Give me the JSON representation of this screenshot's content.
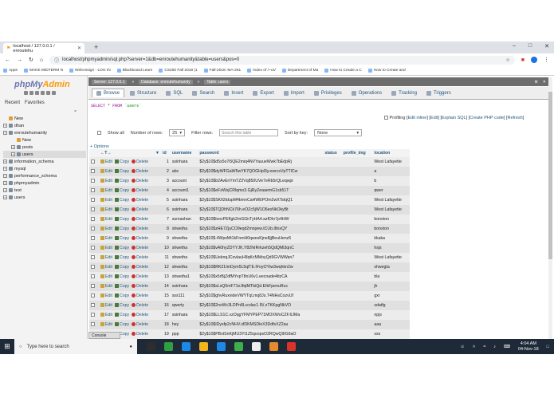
{
  "browser": {
    "tab_title": "localhost / 127.0.0.1 / enroutehu",
    "url": "localhost/phpmyadmin/sql.php?server=1&db=enroutehumanity&table=users&pos=0",
    "bookmarks": [
      "Apps",
      "MAKE MIDTERM N",
      "WebAssign - LOG IN",
      "Blackboard Learn",
      "CS250 Fall 2018 (1",
      "Fall-2018: MA-261",
      "Index of /~cs/",
      "Department of Ma",
      "How to Create a C",
      "How to Create and"
    ]
  },
  "sidebar": {
    "logo_main": "phpMy",
    "logo_accent": "Admin",
    "tabs": [
      "Recent",
      "Favorites"
    ],
    "tree": [
      {
        "label": "New",
        "level": 0,
        "kind": "new"
      },
      {
        "label": "dhan",
        "level": 0,
        "kind": "db"
      },
      {
        "label": "enroutehumanity",
        "level": 0,
        "kind": "db"
      },
      {
        "label": "New",
        "level": 1,
        "kind": "new"
      },
      {
        "label": "posts",
        "level": 1,
        "kind": "table"
      },
      {
        "label": "users",
        "level": 1,
        "kind": "table",
        "selected": true
      },
      {
        "label": "information_schema",
        "level": 0,
        "kind": "db"
      },
      {
        "label": "mysql",
        "level": 0,
        "kind": "db"
      },
      {
        "label": "performance_schema",
        "level": 0,
        "kind": "db"
      },
      {
        "label": "phpmyadmin",
        "level": 0,
        "kind": "db"
      },
      {
        "label": "test",
        "level": 0,
        "kind": "db"
      },
      {
        "label": "users",
        "level": 0,
        "kind": "db"
      }
    ]
  },
  "breadcrumb": {
    "server": "Server: 127.0.0.1",
    "database": "Database: enroutehumanity",
    "table": "Table: users"
  },
  "menu": [
    "Browse",
    "Structure",
    "SQL",
    "Search",
    "Insert",
    "Export",
    "Import",
    "Privileges",
    "Operations",
    "Tracking",
    "Triggers"
  ],
  "query": {
    "select": "SELECT",
    "star": "*",
    "from": "FROM",
    "table": "`users`"
  },
  "profiling": {
    "label": "Profiling",
    "links": [
      "Edit inline",
      "Edit",
      "Explain SQL",
      "Create PHP code",
      "Refresh"
    ]
  },
  "controls": {
    "show_all": "Show all",
    "rows_label": "Number of rows:",
    "rows_value": "25",
    "filter_label": "Filter rows:",
    "filter_placeholder": "Search this table",
    "sort_label": "Sort by key:",
    "sort_value": "None",
    "options_link": "+ Options"
  },
  "actions": {
    "edit": "Edit",
    "copy": "Copy",
    "delete": "Delete"
  },
  "columns": [
    "id",
    "username",
    "password",
    "status",
    "profile_img",
    "location"
  ],
  "rows": [
    {
      "id": "1",
      "username": "ssinhara",
      "password": "$2y$10$d5s5o7i5QE2miq4NVYauueWwk7bEdpRj",
      "location": "West Lafayette"
    },
    {
      "id": "2",
      "username": "abc",
      "password": "$2y$10$dyWFGaW5wYK7QOGHpl3y.ewrcsVpTTlCw",
      "location": "a"
    },
    {
      "id": "3",
      "username": "account",
      "password": "$2y$10$b2AvEnYmTZ2Vq850UVe7eRb5rQLeqwpi",
      "location": "b"
    },
    {
      "id": "4",
      "username": "account1",
      "password": "$2y$10$eFzWsjCRlqmo3.GjRyZeaaemG1sb51T",
      "location": "qwer"
    },
    {
      "id": "5",
      "username": "ssinhara",
      "password": "$2y$10$SKfi2tdupM4bmnCaHWEPOm2wXTsIqQ1",
      "location": "West Lafayette"
    },
    {
      "id": "6",
      "username": "ssinhara",
      "password": "$2y$10$TQDhNCk76h.eOZc5jW1O6esNkOkyBt",
      "location": "West Lafayette"
    },
    {
      "id": "7",
      "username": "sumashan",
      "password": "$2y$10$tvovPEfIgk2mGGirTyHA4.azfDIo7p4HW",
      "location": "bonston"
    },
    {
      "id": "8",
      "username": "shwetha",
      "password": "$2y$10$zHE7ZjuCO9eqd2mnpew.tCUb.l8nxQY",
      "location": "bonston"
    },
    {
      "id": "9",
      "username": "shwetha",
      "password": "$2y$10$.4WpxMt1kFnmH0qwesKjne8jjBeuHenz5",
      "location": "kkaka"
    },
    {
      "id": "10",
      "username": "shwetha",
      "password": "$2y$10$vA0hyZDYYJK.Y82NrRrkzeh5QdQMi3qnC",
      "location": "hsjs"
    },
    {
      "id": "11",
      "username": "shwetha",
      "password": "$2y$10$UeknqJCovlauH8qKcMMoyQd9GVWWan7",
      "location": "West Lafayette"
    },
    {
      "id": "12",
      "username": "shwetha",
      "password": "$2y$10$RK21ImDym5L5qlTE.IFoyOYtw3wqhkn2w",
      "location": "shwegta"
    },
    {
      "id": "13",
      "username": "shwetha1",
      "password": "$2y$10$x5rBjZdfMYvpT8nU6v1.eecnade4ttzCA",
      "location": "bla"
    },
    {
      "id": "14",
      "username": "ssinhara",
      "password": "$2y$10$sLsQ5mF71eJfqtMTbiQd.EIkFpenuRuc",
      "location": "jh"
    },
    {
      "id": "15",
      "username": "sss111",
      "password": "$2y$10$ghvRuxvideVWYTqLmq8Js.T4NHsCozvUf",
      "location": "gxr"
    },
    {
      "id": "16",
      "username": "qwerty",
      "password": "$2y$10$2nxWc3LDPn8Lccdac1.I5/.zTKKpgNkVO",
      "location": "sdatfg"
    },
    {
      "id": "17",
      "username": "ssinhara",
      "password": "$2y$10$LLS1C.vzOqgYFMYPEP71MOXWoCZF.6JMa",
      "location": "npjs"
    },
    {
      "id": "18",
      "username": "hey",
      "password": "$2y$10$IDysfp2cNHV.sfDKMSDleX3DdfsXZ2au",
      "location": "aaa"
    },
    {
      "id": "19",
      "username": "ppp",
      "password": "$2y$10$PBxtSnKjMU3Yt1Z5qoopsO2RQwQ9lG9aO",
      "location": "sss"
    }
  ],
  "console": "Console",
  "taskbar": {
    "search_placeholder": "Type here to search",
    "time": "4:04 AM",
    "date": "04-Nov-18",
    "icon_colors": [
      "#2d2d2d",
      "#2ea043",
      "#1e88e5",
      "#f2b51c",
      "#1e88e5",
      "#3fae49",
      "#eeeeee",
      "#e58a2e",
      "#d7352a"
    ]
  }
}
